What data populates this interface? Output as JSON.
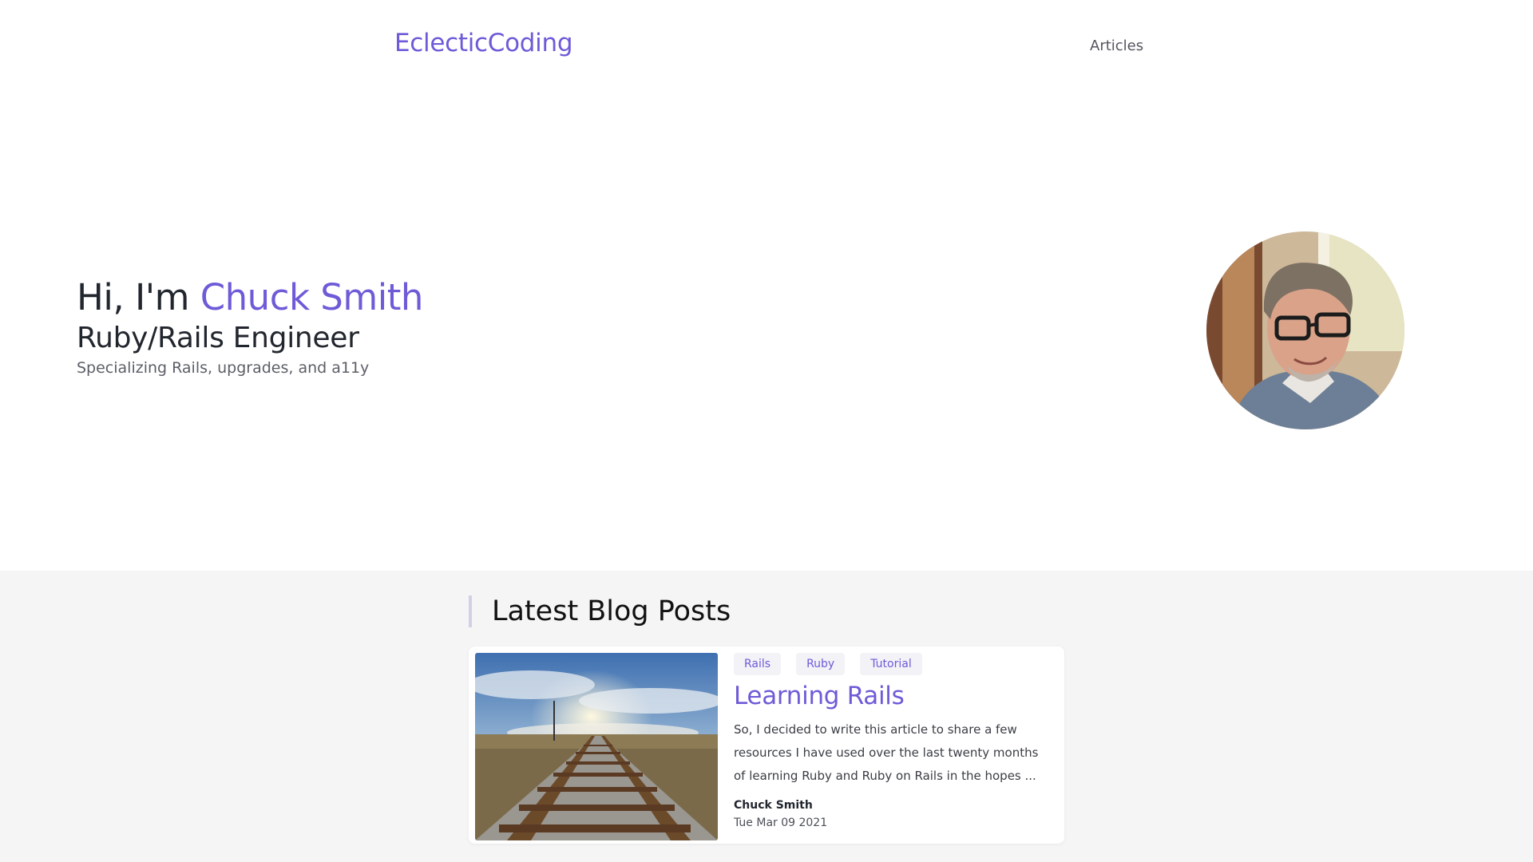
{
  "nav": {
    "brand": "EclecticCoding",
    "links": [
      {
        "label": "Articles"
      }
    ]
  },
  "hero": {
    "greeting": "Hi, I'm ",
    "name": "Chuck Smith",
    "role": "Ruby/Rails Engineer",
    "subtitle": "Specializing Rails, upgrades, and a11y"
  },
  "posts": {
    "section_title": "Latest Blog Posts",
    "items": [
      {
        "tags": [
          "Rails",
          "Ruby",
          "Tutorial"
        ],
        "title": "Learning Rails",
        "excerpt": "So, I decided to write this article to share a few resources I have used over the last twenty months of learning Ruby and Ruby on Rails in the hopes ...",
        "author": "Chuck Smith",
        "date": "Tue Mar 09 2021"
      }
    ]
  },
  "colors": {
    "accent": "#6d5bd8",
    "section_bg": "#f5f5f5",
    "tag_bg": "#f3f2f7"
  }
}
